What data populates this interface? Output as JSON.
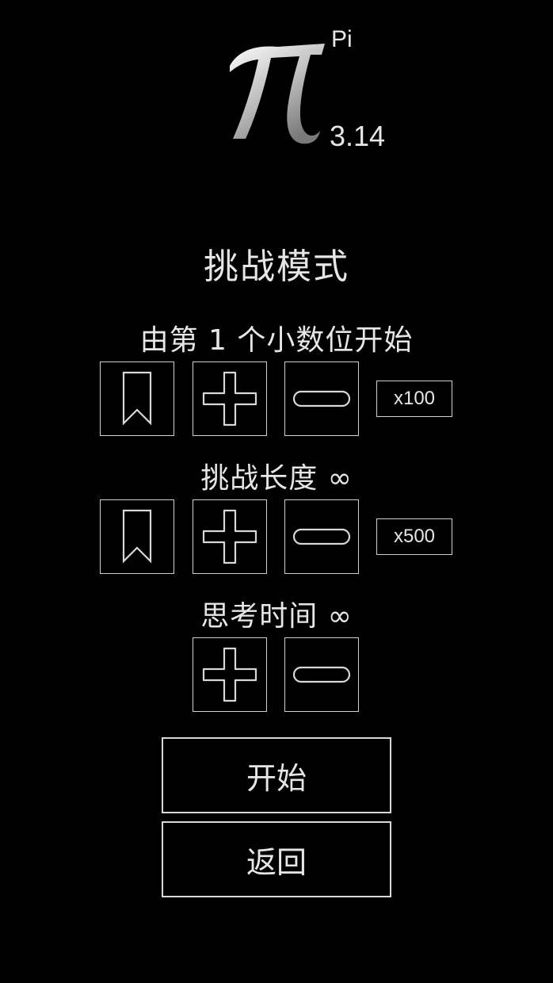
{
  "logo": {
    "symbol": "π",
    "label": "Pi",
    "value": "3.14"
  },
  "title": "挑战模式",
  "sections": {
    "start_digit": {
      "label": "由第 1 个小数位开始",
      "multiplier": "x100"
    },
    "challenge_length": {
      "label": "挑战长度 ∞",
      "multiplier": "x500"
    },
    "think_time": {
      "label": "思考时间 ∞"
    }
  },
  "buttons": {
    "start": "开始",
    "back": "返回"
  },
  "icons": [
    "bookmark-icon",
    "plus-icon",
    "minus-icon"
  ],
  "colors": {
    "background": "#000000",
    "foreground": "#e6e6e6",
    "border": "#cfcfcf"
  }
}
